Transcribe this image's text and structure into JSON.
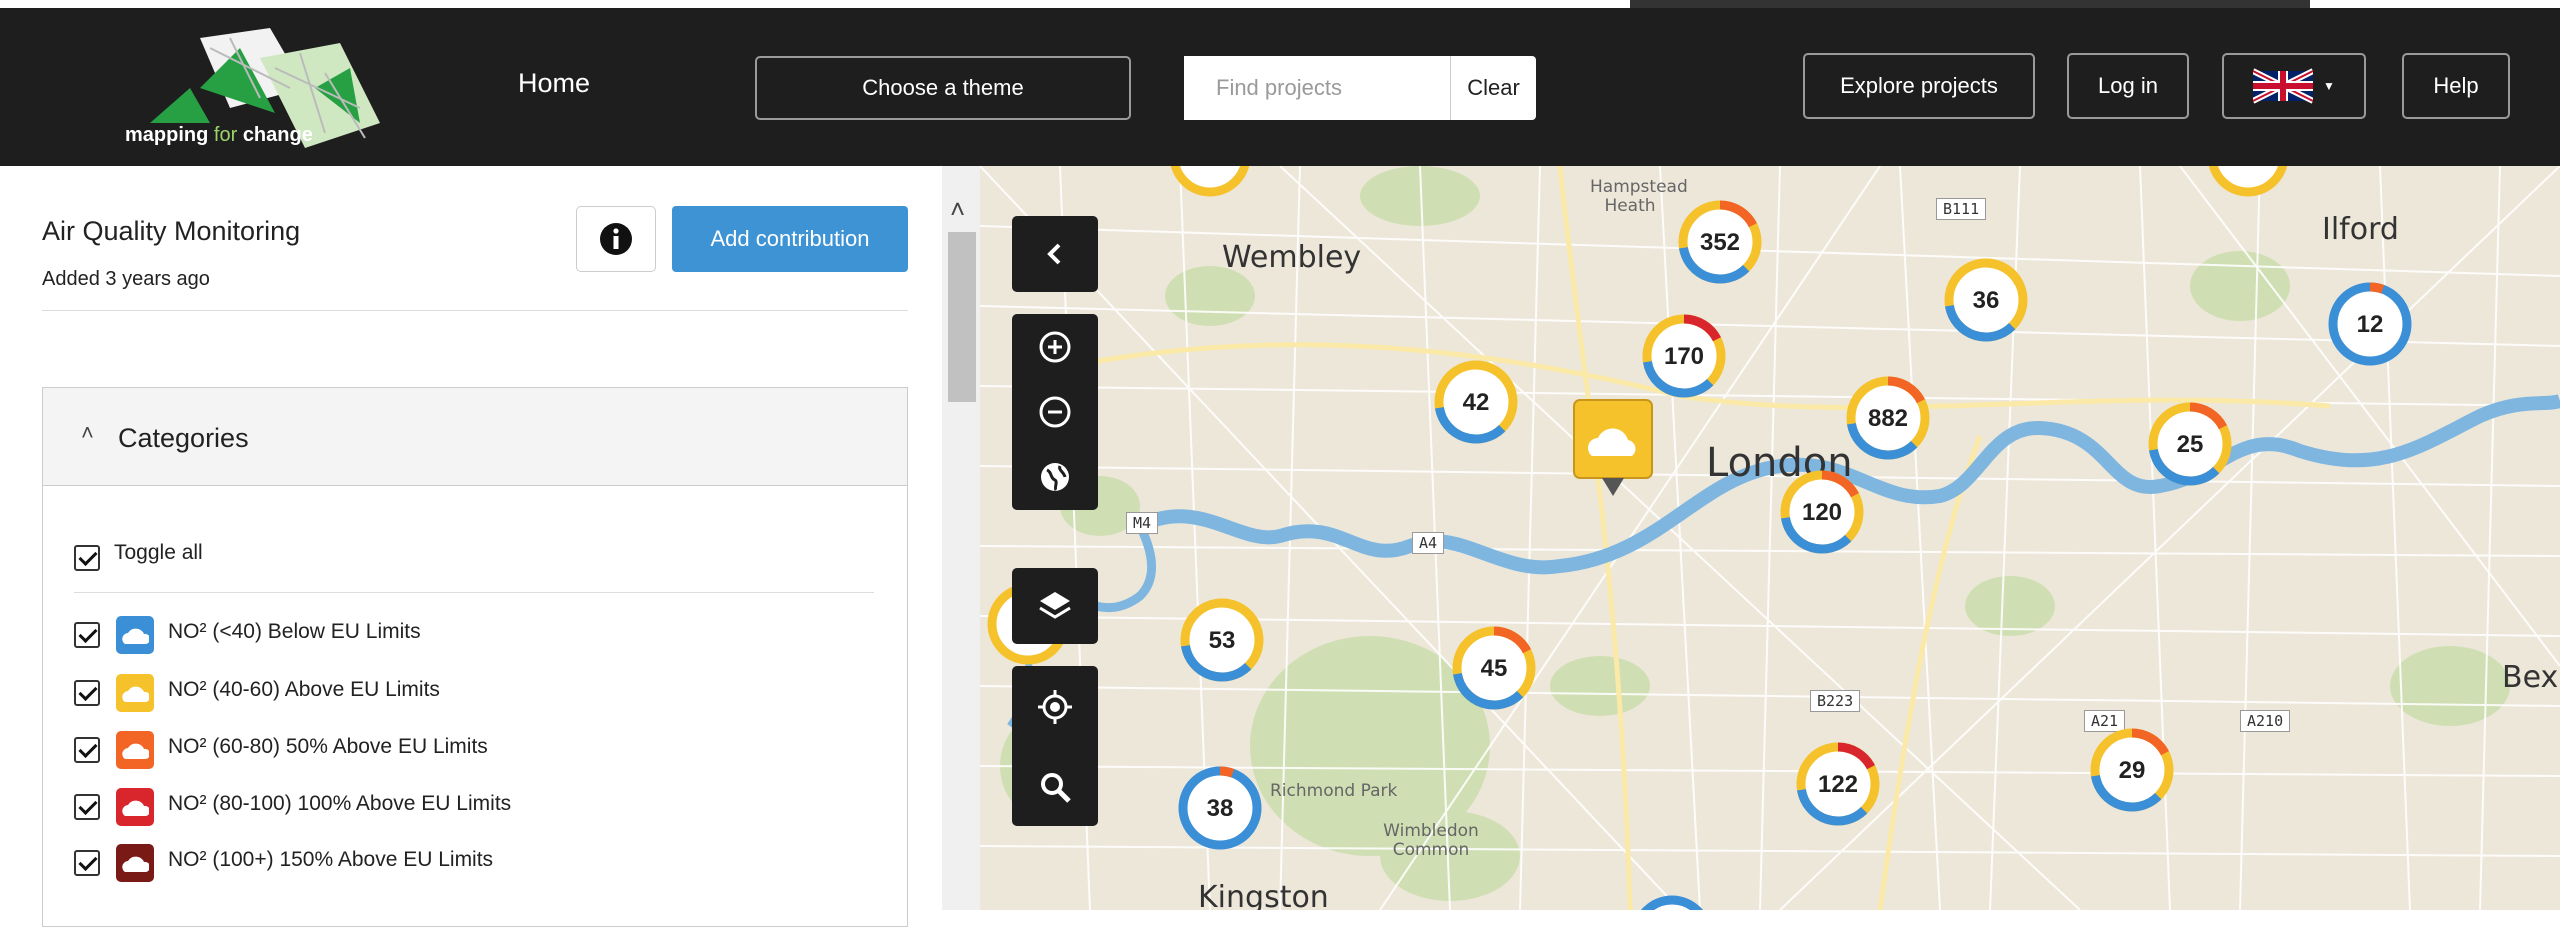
{
  "header": {
    "logo_text_bold": "mapping",
    "logo_text_thin": "for",
    "logo_text_end": "change",
    "home_label": "Home",
    "theme_label": "Choose a theme",
    "search_placeholder": "Find projects",
    "clear_label": "Clear",
    "explore_label": "Explore projects",
    "login_label": "Log in",
    "language_icon": "uk-flag-icon",
    "help_label": "Help"
  },
  "project": {
    "title": "Air Quality Monitoring",
    "subtitle": "Added 3 years ago",
    "info_icon": "info-icon",
    "add_label": "Add contribution"
  },
  "categories": {
    "heading": "Categories",
    "toggle_all": "Toggle all",
    "items": [
      {
        "label": "NO² (<40) Below EU Limits",
        "color": "#3b8fd6"
      },
      {
        "label": "NO² (40-60) Above EU Limits",
        "color": "#f5c22c"
      },
      {
        "label": "NO² (60-80) 50% Above EU Limits",
        "color": "#f26524"
      },
      {
        "label": "NO² (80-100) 100% Above EU Limits",
        "color": "#d8262c"
      },
      {
        "label": "NO² (100+) 150% Above EU Limits",
        "color": "#7a1a16"
      }
    ]
  },
  "map": {
    "places": {
      "wembley": "Wembley",
      "london": "London",
      "ilford": "Ilford",
      "bexley": "Bexle",
      "kingston": "Kingston",
      "hampstead": "Hampstead Heath",
      "richmond": "Richmond Park",
      "wimbledon": "Wimbledon Common"
    },
    "roads": [
      "B111",
      "M4",
      "A4",
      "B223",
      "A21",
      "A210"
    ],
    "clusters": [
      "352",
      "36",
      "12",
      "170",
      "42",
      "882",
      "25",
      "120",
      "53",
      "45",
      "122",
      "29",
      "38"
    ],
    "colors": {
      "low": "#3b8fd6",
      "mid": "#f5c22c",
      "high": "#f26524",
      "max": "#d8262c"
    }
  }
}
